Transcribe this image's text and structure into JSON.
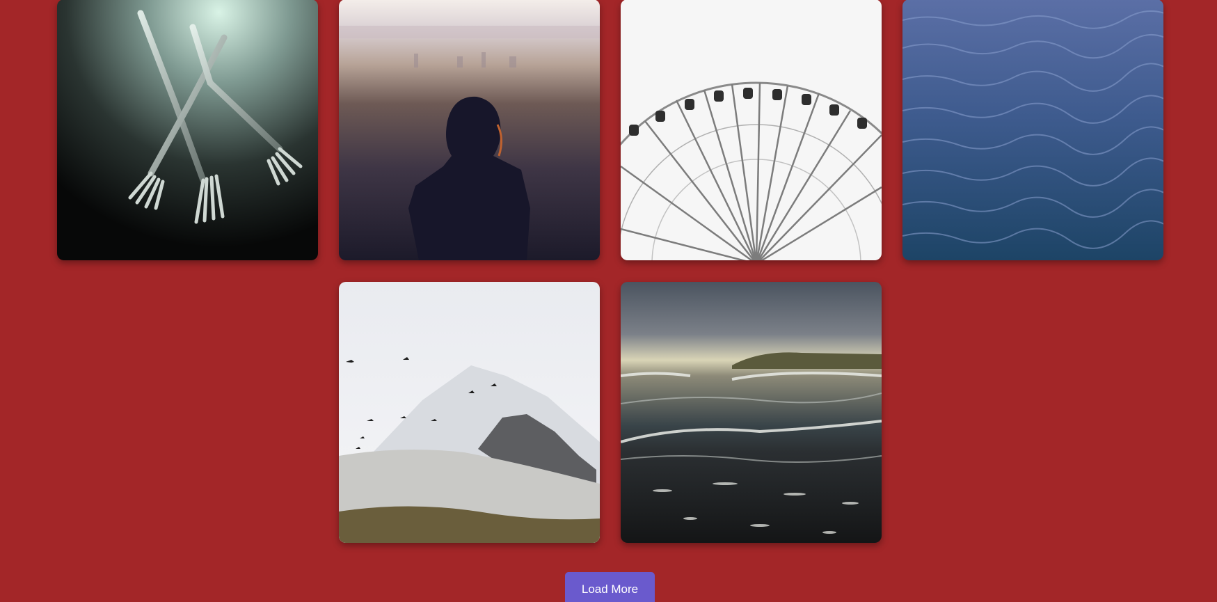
{
  "gallery": {
    "images": [
      {
        "subject": "forks"
      },
      {
        "subject": "woman-overlooking-city"
      },
      {
        "subject": "ferris-wheel"
      },
      {
        "subject": "ocean-water"
      },
      {
        "subject": "snowy-mountain-birds"
      },
      {
        "subject": "beach-waves"
      }
    ]
  },
  "load_more": {
    "label": "Load More"
  },
  "colors": {
    "background": "#a32628",
    "button": "#6a5acd",
    "button_text": "#ffffff"
  }
}
